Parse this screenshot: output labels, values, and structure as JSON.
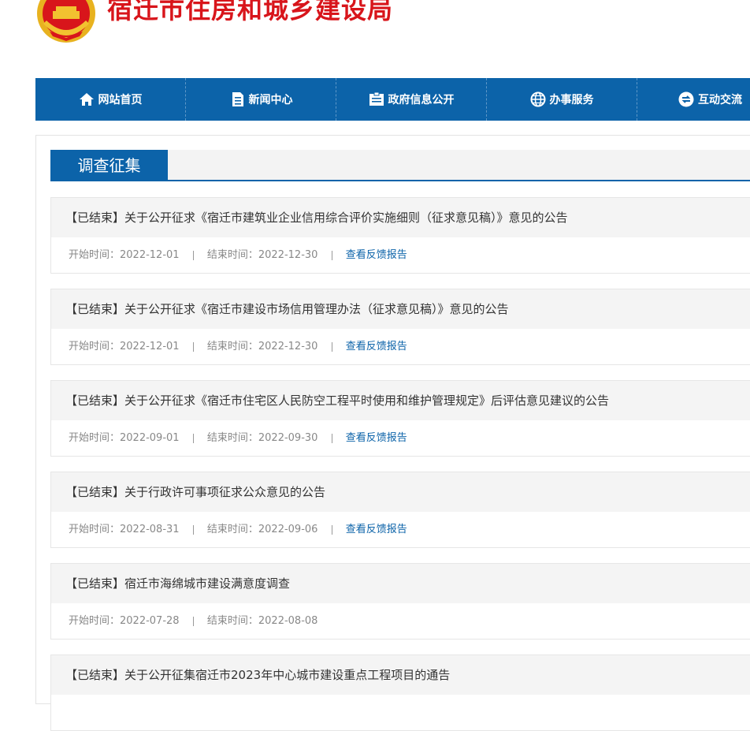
{
  "header": {
    "site_title": "宿迁市住房和城乡建设局"
  },
  "nav": {
    "items": [
      {
        "label": "网站首页",
        "icon": "home-icon"
      },
      {
        "label": "新闻中心",
        "icon": "document-icon"
      },
      {
        "label": "政府信息公开",
        "icon": "info-icon"
      },
      {
        "label": "办事服务",
        "icon": "globe-icon"
      },
      {
        "label": "互动交流",
        "icon": "exchange-icon"
      }
    ]
  },
  "section": {
    "title": "调查征集"
  },
  "colors": {
    "brand_blue": "#0c63a9",
    "title_red": "#d8151b"
  },
  "items": [
    {
      "status": "【已结束】",
      "title": "关于公开征求《宿迁市建筑业企业信用综合评价实施细则（征求意见稿）》意见的公告",
      "start_label": "开始时间：",
      "start": "2022-12-01",
      "end_label": "结束时间：",
      "end": "2022-12-30",
      "report": "查看反馈报告"
    },
    {
      "status": "【已结束】",
      "title": "关于公开征求《宿迁市建设市场信用管理办法（征求意见稿）》意见的公告",
      "start_label": "开始时间：",
      "start": "2022-12-01",
      "end_label": "结束时间：",
      "end": "2022-12-30",
      "report": "查看反馈报告"
    },
    {
      "status": "【已结束】",
      "title": "关于公开征求《宿迁市住宅区人民防空工程平时使用和维护管理规定》后评估意见建议的公告",
      "start_label": "开始时间：",
      "start": "2022-09-01",
      "end_label": "结束时间：",
      "end": "2022-09-30",
      "report": "查看反馈报告"
    },
    {
      "status": "【已结束】",
      "title": "关于行政许可事项征求公众意见的公告",
      "start_label": "开始时间：",
      "start": "2022-08-31",
      "end_label": "结束时间：",
      "end": "2022-09-06",
      "report": "查看反馈报告"
    },
    {
      "status": "【已结束】",
      "title": "宿迁市海绵城市建设满意度调查",
      "start_label": "开始时间：",
      "start": "2022-07-28",
      "end_label": "结束时间：",
      "end": "2022-08-08",
      "report": ""
    },
    {
      "status": "【已结束】",
      "title": "关于公开征集宿迁市2023年中心城市建设重点工程项目的通告",
      "start_label": "",
      "start": "",
      "end_label": "",
      "end": "",
      "report": ""
    }
  ]
}
